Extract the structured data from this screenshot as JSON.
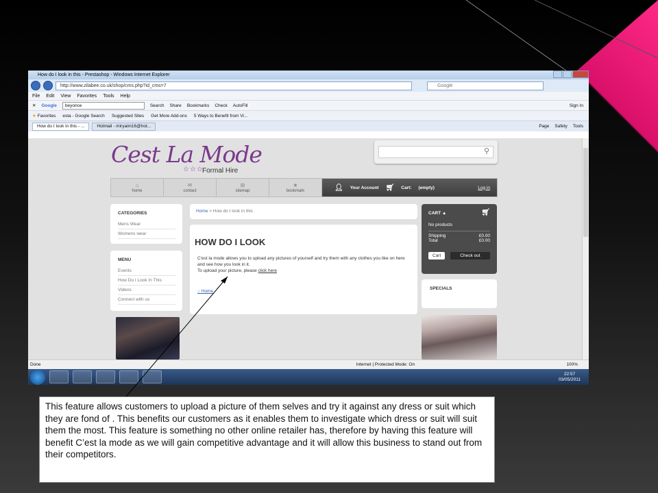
{
  "browser": {
    "title": "How do I look in this - Prestashop - Windows Internet Explorer",
    "url": "http://www.zilabee.co.uk/shop/cms.php?id_cms=7",
    "search_placeholder": "Google",
    "menu": [
      "File",
      "Edit",
      "View",
      "Favorites",
      "Tools",
      "Help"
    ],
    "google_query": "beyonce",
    "google_items": [
      "Search",
      "Share",
      "Bookmarks",
      "Check",
      "AutoFill",
      "Sign In"
    ],
    "favorites_label": "Favorites",
    "favorites": [
      "esta - Google Search",
      "Suggested Sites",
      "Get More Add-ons",
      "5 Ways to Benefit from Vi..."
    ],
    "tabs": [
      "How do I look in this - ...",
      "Hotmail - miryaim16@hot..."
    ],
    "tab_tools": [
      "Page",
      "Safety",
      "Tools"
    ],
    "status": "Done",
    "zone": "Internet | Protected Mode: On",
    "zoom": "100%",
    "time": "22:57",
    "date": "03/05/2011"
  },
  "site": {
    "logo": "Cest La Mode",
    "logo_sub": "Formal Hire",
    "nav": [
      {
        "label": "home",
        "icon": "home-icon"
      },
      {
        "label": "contact",
        "icon": "mail-icon"
      },
      {
        "label": "sitemap",
        "icon": "sitemap-icon"
      },
      {
        "label": "bookmark",
        "icon": "star-icon"
      }
    ],
    "account_label": "Your Account",
    "cart_label": "Cart:",
    "cart_state": "(empty)",
    "login": "Log in",
    "categories_title": "CATEGORIES",
    "categories": [
      "Mens Wear",
      "Womens wear"
    ],
    "menu_title": "MENU",
    "menu_items": [
      "Events",
      "How Do I Look In This",
      "Videos",
      "Connect with us"
    ],
    "breadcrumb_home": "Home",
    "breadcrumb_sep": ">",
    "breadcrumb_current": "How do I look in this",
    "page_title": "HOW DO I LOOK",
    "body_1": "C'est la mode allows you to upload any pictures of yourself and try them with any clothes you like on here and see how you look in it.",
    "body_2": "To upload your picture, please",
    "body_link": "click here",
    "home_link": "Home",
    "cart_title": "CART",
    "cart_empty": "No products",
    "shipping_label": "Shipping",
    "shipping_value": "£0.00",
    "total_label": "Total",
    "total_value": "£0.00",
    "cart_button": "Cart",
    "checkout_button": "Check out",
    "specials_title": "SPECIALS"
  },
  "note": "This feature allows customers to upload a picture of them selves and try it against any dress or suit which they are fond of . This benefits our customers as it enables them to investigate which dress or suit will suit them the most. This feature is something no other online retailer has, therefore by having this feature will benefit C’est la mode  as we will gain competitive advantage and it will allow this business to stand out from their competitors.",
  "colors": {
    "accent_pink": "#e8176f",
    "logo_purple": "#7a3a8c"
  }
}
